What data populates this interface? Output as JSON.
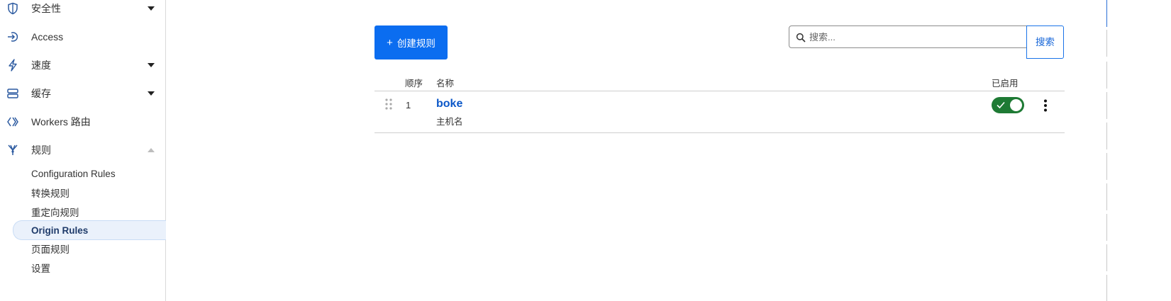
{
  "sidebar": {
    "items": [
      {
        "label": "安全性",
        "icon": "shield-icon",
        "caret": "down"
      },
      {
        "label": "Access",
        "icon": "access-icon",
        "caret": ""
      },
      {
        "label": "速度",
        "icon": "lightning-icon",
        "caret": "down"
      },
      {
        "label": "缓存",
        "icon": "cache-icon",
        "caret": "down"
      },
      {
        "label": "Workers 路由",
        "icon": "workers-icon",
        "caret": ""
      },
      {
        "label": "规则",
        "icon": "rules-icon",
        "caret": "up"
      }
    ],
    "sub_items": [
      {
        "label": "Configuration Rules"
      },
      {
        "label": "转换规则"
      },
      {
        "label": "重定向规则"
      },
      {
        "label": "Origin Rules",
        "active": true
      },
      {
        "label": "页面规则"
      },
      {
        "label": "设置"
      }
    ]
  },
  "main": {
    "create_button_label": "创建规则",
    "search": {
      "placeholder": "搜索...",
      "value": "",
      "button_label": "搜索"
    },
    "table": {
      "headers": {
        "order": "顺序",
        "name": "名称",
        "enabled": "已启用"
      },
      "rows": [
        {
          "order": "1",
          "name": "boke",
          "subtitle": "主机名",
          "enabled": true
        }
      ]
    }
  },
  "colors": {
    "primary": "#0b6df0",
    "link": "#0b57c8",
    "toggle_on": "#1e7a34",
    "active_bg": "#eaf1fb"
  }
}
